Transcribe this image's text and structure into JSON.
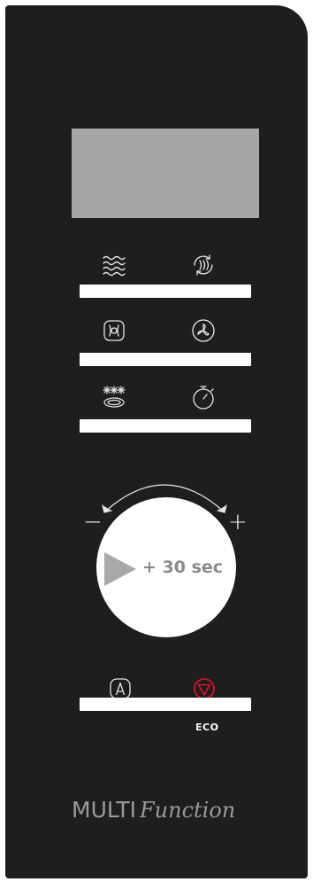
{
  "panel": {
    "display": {
      "text": ""
    },
    "rows": [
      {
        "left_icon": "microwave-waves-icon",
        "right_icon": "grill-microwave-combo-icon"
      },
      {
        "left_icon": "grill-fan-icon",
        "right_icon": "convection-fan-icon"
      },
      {
        "left_icon": "defrost-icon",
        "right_icon": "timer-icon"
      }
    ],
    "knob": {
      "minus_symbol": "−",
      "plus_symbol": "+",
      "start_label": "+ 30 sec",
      "play_icon": "play-icon",
      "arc_icon": "rotate-arrows-icon"
    },
    "bottom_row": {
      "left_icon": "auto-programs-icon",
      "right_icon": "eco-stop-icon",
      "eco_label": "ECO",
      "eco_color": "#e0162b"
    },
    "brand": {
      "multi": "MULTI",
      "function": "Function"
    }
  }
}
